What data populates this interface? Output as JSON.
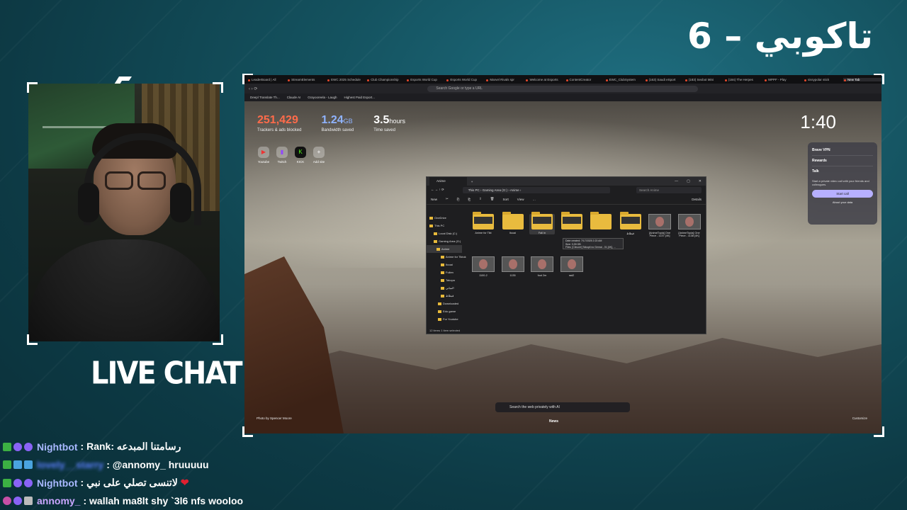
{
  "overlay": {
    "title": "تاكوبي – 6",
    "live_chat": "LIVE CHAT"
  },
  "chat": [
    {
      "name": "Nightbot",
      "name_style": "bot",
      "badges": [
        "green",
        "purple",
        "purple"
      ],
      "message": ": Rank: رسامتنا المبدعه"
    },
    {
      "name": "lovely__starry",
      "name_style": "blur",
      "badges": [
        "green",
        "blue",
        "blue"
      ],
      "message": ": @annomy_ hruuuuu"
    },
    {
      "name": "Nightbot",
      "name_style": "bot",
      "badges": [
        "green",
        "purple",
        "purple"
      ],
      "message": ": لاتنسى تصلي على نبي",
      "heart": "❤"
    },
    {
      "name": "annomy_",
      "name_style": "anon",
      "badges": [
        "pink",
        "purple",
        "gray"
      ],
      "message": ": wallah ma8lt shy `3l6 nfs wooloo"
    }
  ],
  "browser": {
    "tabs": [
      "LeaderBoard | All",
      "StreamElements",
      "EWC 2025 Schedule",
      "Club Championship",
      "Esports World Cup",
      "Esports World Cup",
      "Marvel Rivals spr",
      "Welcome at Esports",
      "ContentCreator",
      "EWC_ClubSystem",
      "(163) Saudi eSport",
      "(183) Sexbot Mini",
      "(184) The Herpes",
      "WPPF - Play",
      "sissypolar stick",
      "New Tab"
    ],
    "active_tab": "New Tab",
    "address_placeholder": "Search Google or type a URL",
    "bookmarks": [
      "Deepl Translate Th...",
      "Claude AI",
      "Grayooreela - Laugh",
      "Highest Paid Esport..."
    ],
    "stats": [
      {
        "value": "251,429",
        "unit": "",
        "label": "Trackers & ads blocked",
        "color": "#ff6b4a"
      },
      {
        "value": "1.24",
        "unit": "GB",
        "label": "Bandwidth saved",
        "color": "#8fb3ff"
      },
      {
        "value": "3.5",
        "unit": "hours",
        "label": "Time saved",
        "color": "#ffffff"
      }
    ],
    "clock": "1:40",
    "shortcuts": [
      {
        "label": "Youtube",
        "icon": "▶",
        "color": "#e33"
      },
      {
        "label": "Twitch",
        "icon": "▮",
        "color": "#9146ff"
      },
      {
        "label": "KICK",
        "icon": "K",
        "color": "#53fc18"
      },
      {
        "label": "Add site",
        "icon": "+",
        "color": "#888"
      }
    ],
    "rewards_panel": {
      "items": [
        "Brave VPN",
        "Rewards",
        "Talk"
      ],
      "talk_text": "Start a private video call with your friends and colleagues.",
      "button": "Start call",
      "footer": "About your data"
    },
    "search_placeholder": "Search the web privately with AI",
    "news_label": "News",
    "photo_credit": "Photo by Spencer Moore",
    "customize": "Customize"
  },
  "explorer": {
    "tab_title": "Anime",
    "controls": [
      "—",
      "▢",
      "✕"
    ],
    "path": [
      "This PC",
      "Gaming Area (G:)",
      "Anime"
    ],
    "search_placeholder": "Search Anime",
    "toolbar": [
      "New",
      "✂",
      "⎘",
      "⎗",
      "⇪",
      "🗑",
      "Sort",
      "View",
      "…"
    ],
    "details": "Details",
    "sidebar": [
      "OneDrive",
      "This PC",
      "Local Disk (C:)",
      "Gaming Area (G:)",
      "Anime",
      "Anime for Tiktok",
      "Itooai",
      "Fullen",
      "Takopa",
      "البنياني",
      "قبطاط",
      "Downloaded",
      "Edo game",
      "For Youtube"
    ],
    "items_row1": [
      {
        "name": "Anime for Tikt",
        "type": "folder-thumb"
      },
      {
        "name": "Itooai",
        "type": "folder"
      },
      {
        "name": "Fall in",
        "type": "folder-thumb",
        "selected": true
      },
      {
        "name": "",
        "type": "folder-thumb"
      },
      {
        "name": "",
        "type": "folder"
      },
      {
        "name": "قبطاط",
        "type": "folder-thumb"
      },
      {
        "name": "[AnimeTopia] One Piece - 1137 [4K]",
        "type": "video"
      },
      {
        "name": "[AnimeTopia] One Piece - 1138 [4K]",
        "type": "video"
      }
    ],
    "items_row2": [
      {
        "name": "1100-2",
        "type": "video"
      },
      {
        "name": "1135",
        "type": "video"
      },
      {
        "name": "foot 2m",
        "type": "video"
      },
      {
        "name": "rad2",
        "type": "video"
      }
    ],
    "tooltip": [
      "Date created: 7/17/2025 2:23 AM",
      "Size: 3.39 GB",
      "Files: [Cleuore] Takopii no Genrai - 01 [4K], ..."
    ],
    "status": "12 items   1 item selected"
  }
}
